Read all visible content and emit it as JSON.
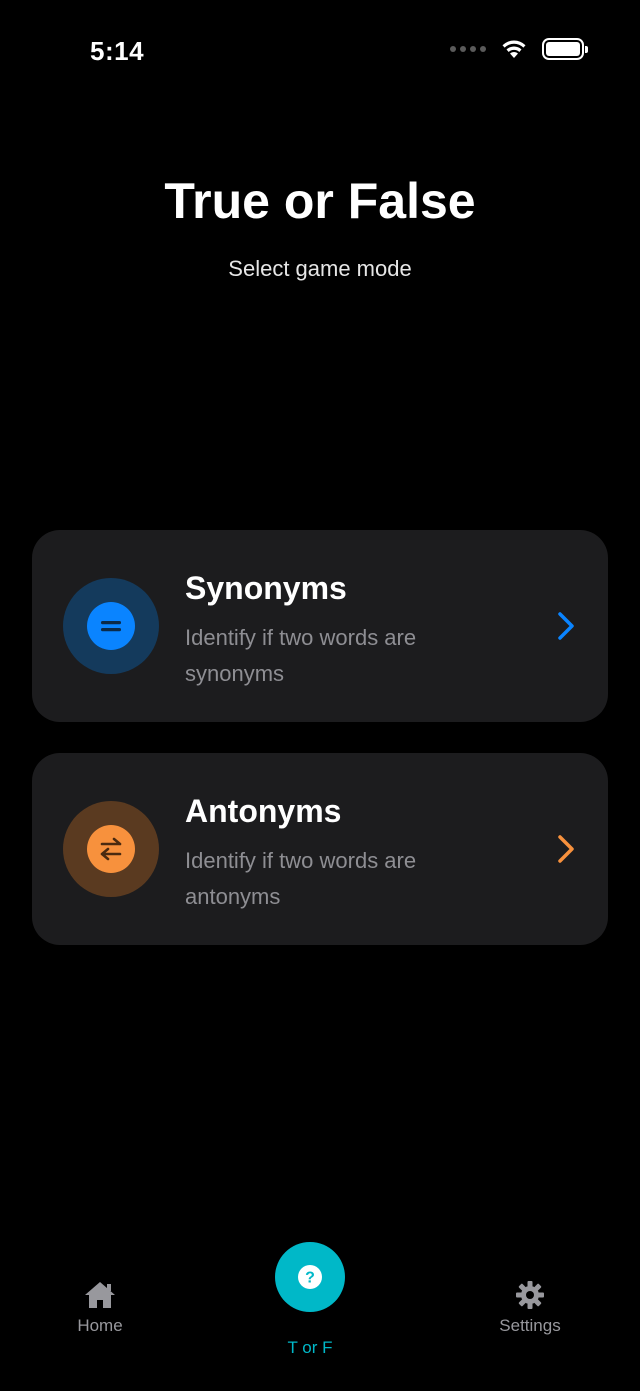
{
  "status_bar": {
    "time": "5:14"
  },
  "header": {
    "title": "True or False",
    "subtitle": "Select game mode"
  },
  "modes": [
    {
      "title": "Synonyms",
      "description": "Identify if two words are synonyms",
      "icon": "equals-icon",
      "accent": "#0a84ff",
      "icon_bg": "#143a5c"
    },
    {
      "title": "Antonyms",
      "description": "Identify if two words are antonyms",
      "icon": "swap-arrows-icon",
      "accent": "#f7913d",
      "icon_bg": "#5a3a20"
    }
  ],
  "tab_bar": {
    "home_label": "Home",
    "center_label": "T or F",
    "settings_label": "Settings",
    "active_color": "#00b8c8"
  }
}
